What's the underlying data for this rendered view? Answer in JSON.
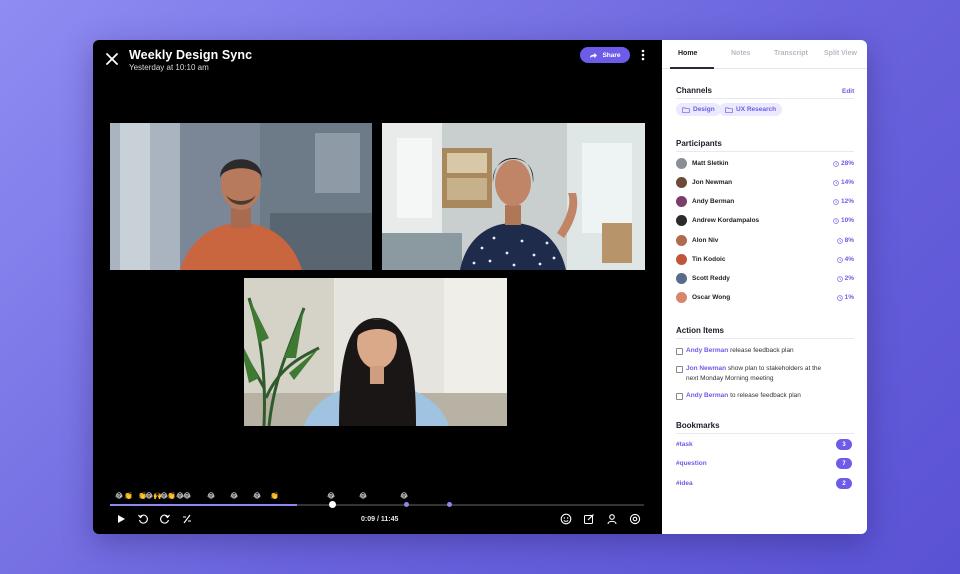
{
  "meeting": {
    "title": "Weekly Design Sync",
    "subtitle": "Yesterday at 10:10 am",
    "share_label": "Share"
  },
  "player": {
    "time": "0:09 / 11:45",
    "progress_fraction": 0.35,
    "emojis": [
      "😂",
      "👏",
      "👏",
      "😂",
      "🙌",
      "😂",
      "👏",
      "😂",
      "😂",
      "😂",
      "😂",
      "😂",
      "👏",
      "😂",
      "😂",
      "😂"
    ]
  },
  "tabs": [
    {
      "label": "Home",
      "active": true
    },
    {
      "label": "Notes",
      "active": false
    },
    {
      "label": "Transcript",
      "active": false
    },
    {
      "label": "Split View",
      "active": false
    }
  ],
  "channels": {
    "title": "Channels",
    "edit_label": "Edit",
    "items": [
      "Design",
      "UX Research"
    ]
  },
  "participants": {
    "title": "Participants",
    "items": [
      {
        "name": "Matt Sletkin",
        "pct": "28%"
      },
      {
        "name": "Jon Newman",
        "pct": "14%"
      },
      {
        "name": "Andy Berman",
        "pct": "12%"
      },
      {
        "name": "Andrew Kordampalos",
        "pct": "10%"
      },
      {
        "name": "Alon Niv",
        "pct": "8%"
      },
      {
        "name": "Tin Kodoic",
        "pct": "4%"
      },
      {
        "name": "Scott Reddy",
        "pct": "2%"
      },
      {
        "name": "Oscar Wong",
        "pct": "1%"
      }
    ]
  },
  "action_items": {
    "title": "Action Items",
    "items": [
      {
        "who": "Andy Berman",
        "text": " release feedback plan"
      },
      {
        "who": "Jon Newman",
        "text": " show plan to stakeholders at the next Monday Morning meeting"
      },
      {
        "who": "Andy Berman",
        "text": " to release feedback plan"
      }
    ]
  },
  "bookmarks": {
    "title": "Bookmarks",
    "items": [
      {
        "tag": "#task",
        "count": "3"
      },
      {
        "tag": "#question",
        "count": "7"
      },
      {
        "tag": "#idea",
        "count": "2"
      }
    ]
  },
  "colors": {
    "accent": "#6c5ce7",
    "background_gradient_start": "#8f8cf2",
    "background_gradient_end": "#5a52d4"
  }
}
